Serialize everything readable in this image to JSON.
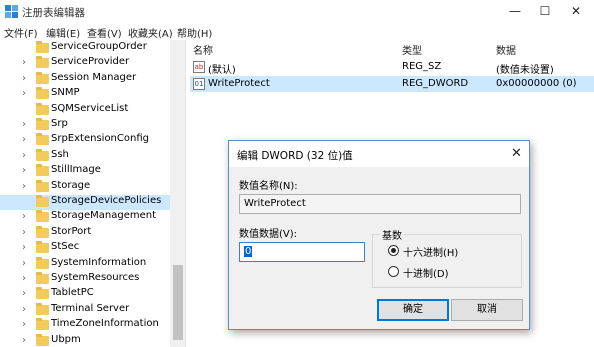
{
  "window": {
    "title": "注册表编辑器",
    "controls": {
      "minimize": "—",
      "maximize": "☐",
      "close": "✕"
    }
  },
  "menu": [
    "文件(F)",
    "编辑(E)",
    "查看(V)",
    "收藏夹(A)",
    "帮助(H)"
  ],
  "tree": {
    "items": [
      {
        "label": "ServiceGroupOrder",
        "expandable": false
      },
      {
        "label": "ServiceProvider",
        "expandable": true
      },
      {
        "label": "Session Manager",
        "expandable": true
      },
      {
        "label": "SNMP",
        "expandable": true
      },
      {
        "label": "SQMServiceList",
        "expandable": false
      },
      {
        "label": "Srp",
        "expandable": true
      },
      {
        "label": "SrpExtensionConfig",
        "expandable": true
      },
      {
        "label": "Ssh",
        "expandable": true
      },
      {
        "label": "StillImage",
        "expandable": true
      },
      {
        "label": "Storage",
        "expandable": true
      },
      {
        "label": "StorageDevicePolicies",
        "expandable": false,
        "selected": true
      },
      {
        "label": "StorageManagement",
        "expandable": true
      },
      {
        "label": "StorPort",
        "expandable": true
      },
      {
        "label": "StSec",
        "expandable": true
      },
      {
        "label": "SystemInformation",
        "expandable": true
      },
      {
        "label": "SystemResources",
        "expandable": true
      },
      {
        "label": "TabletPC",
        "expandable": true
      },
      {
        "label": "Terminal Server",
        "expandable": true
      },
      {
        "label": "TimeZoneInformation",
        "expandable": true
      },
      {
        "label": "Ubpm",
        "expandable": true
      }
    ]
  },
  "list": {
    "headers": {
      "name": "名称",
      "type": "类型",
      "data": "数据"
    },
    "rows": [
      {
        "icon": "ab",
        "name": "(默认)",
        "type": "REG_SZ",
        "data": "(数值未设置)",
        "selected": false
      },
      {
        "icon": "bin",
        "name": "WriteProtect",
        "type": "REG_DWORD",
        "data": "0x00000000 (0)",
        "selected": true
      }
    ]
  },
  "dialog": {
    "title": "编辑 DWORD (32 位)值",
    "close": "✕",
    "name_label": "数值名称(N):",
    "name_value": "WriteProtect",
    "data_label": "数值数据(V):",
    "data_value": "0",
    "base_title": "基数",
    "base_options": [
      {
        "label": "十六进制(H)",
        "checked": true
      },
      {
        "label": "十进制(D)",
        "checked": false
      }
    ],
    "ok": "确定",
    "cancel": "取消"
  },
  "colors": {
    "selection": "#cce8ff",
    "folder": "#f2cb5c",
    "dialog_border": "#5a8ecb",
    "focus": "#0078d7"
  }
}
